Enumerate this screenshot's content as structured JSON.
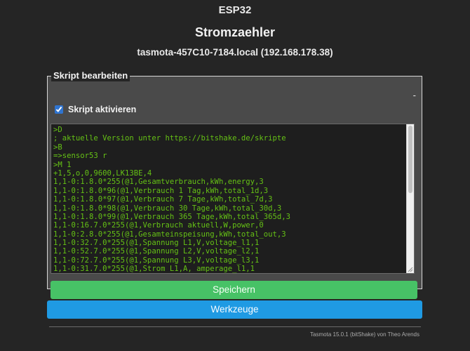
{
  "header": {
    "device": "ESP32",
    "name": "Stromzaehler",
    "host": "tasmota-457C10-7184.local (192.168.178.38)"
  },
  "editor": {
    "legend": "Skript bearbeiten",
    "dash": "-",
    "activate_label": "Skript aktivieren",
    "activate_checked": true,
    "code_lines": [
      ">D",
      "; aktuelle Version unter https://bitshake.de/skripte",
      ">B",
      "=>sensor53 r",
      ">M 1",
      "+1,5,o,0,9600,LK13BE,4",
      "1,1-0:1.8.0*255(@1,Gesamtverbrauch,kWh,energy,3",
      "1,1-0:1.8.0*96(@1,Verbrauch 1 Tag,kWh,total_1d,3",
      "1,1-0:1.8.0*97(@1,Verbrauch 7 Tage,kWh,total_7d,3",
      "1,1-0:1.8.0*98(@1,Verbrauch 30 Tage,kWh,total_30d,3",
      "1,1-0:1.8.0*99(@1,Verbrauch 365 Tage,kWh,total_365d,3",
      "1,1-0:16.7.0*255(@1,Verbrauch aktuell,W,power,0",
      "1,1-0:2.8.0*255(@1,Gesamteinspeisung,kWh,total_out,3",
      "1,1-0:32.7.0*255(@1,Spannung L1,V,voltage_l1,1",
      "1,1-0:52.7.0*255(@1,Spannung L2,V,voltage_l2,1",
      "1,1-0:72.7.0*255(@1,Spannung L3,V,voltage_l3,1",
      "1,1-0:31.7.0*255(@1,Strom L1,A, amperage_l1,1"
    ],
    "save_label": "Speichern"
  },
  "tools_label": "Werkzeuge",
  "footer": "Tasmota 15.0.1 (bitShake) von Theo Arends",
  "colors": {
    "background": "#252525",
    "panel": "#4a4a4a",
    "code_text": "#65c115",
    "save_button": "#47c266",
    "tools_button": "#1f9ae3"
  },
  "icons": {
    "activate_checkbox": "checkbox-checked-icon",
    "resize": "resize-grip-icon"
  }
}
